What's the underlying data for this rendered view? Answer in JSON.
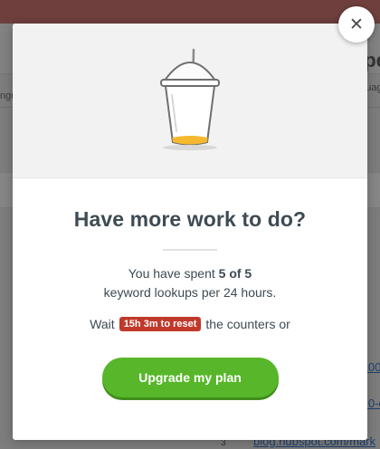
{
  "background": {
    "heading_fragment": "xpe",
    "subtab_right": "nguag",
    "subtab_left": "ngu",
    "links": [
      "/100",
      "/10-c",
      "blog.hubspot.com/mark"
    ],
    "row_number": "3"
  },
  "modal": {
    "close_icon": "close-icon",
    "close_glyph": "✕",
    "illustration": "empty-cup-icon",
    "title": "Have more work to do?",
    "usage_prefix": "You have spent",
    "usage_count": "5 of 5",
    "usage_suffix": "keyword lookups per 24 hours.",
    "reset_prefix": "Wait",
    "reset_badge": "15h 3m to reset",
    "reset_suffix": "the counters or",
    "upgrade_label": "Upgrade my plan"
  },
  "colors": {
    "accent_green": "#58b62a",
    "badge_red": "#c0392b",
    "title_text": "#3e4b53",
    "liquid": "#f5b82e"
  }
}
